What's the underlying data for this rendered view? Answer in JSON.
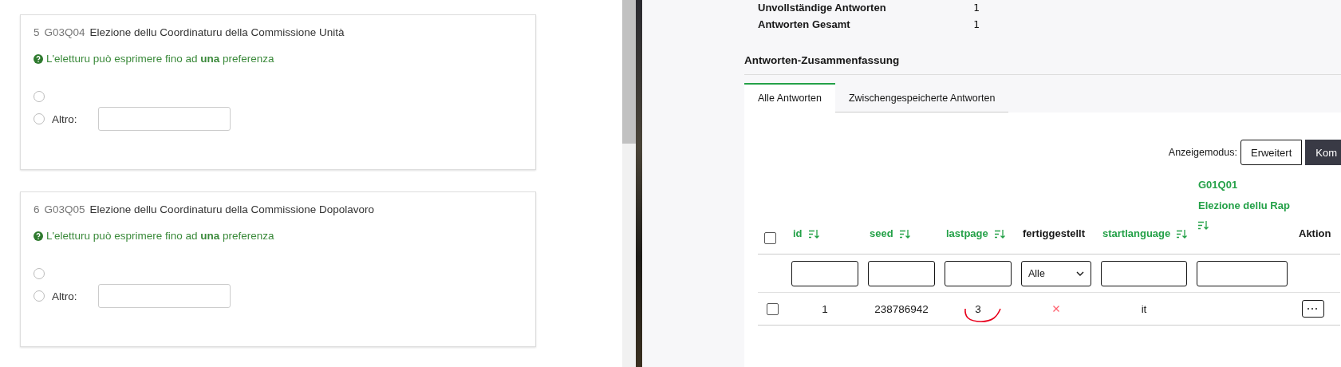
{
  "questions": [
    {
      "number": "5",
      "code": "G03Q04",
      "title": "Elezione dellu Coordinaturu della Commissione Unità",
      "help": "L'eletturu può esprimere fino ad **una** preferenza",
      "options": [
        {
          "kind": "blank",
          "selected": false
        },
        {
          "kind": "other",
          "label": "Altro:",
          "selected": false
        }
      ]
    },
    {
      "number": "6",
      "code": "G03Q05",
      "title": "Elezione dellu Coordinaturu della Commissione Dopolavoro",
      "help": "L'eletturu può esprimere fino ad **una** preferenza",
      "options": [
        {
          "kind": "blank",
          "selected": false
        },
        {
          "kind": "other",
          "label": "Altro:",
          "selected": false
        }
      ]
    }
  ],
  "stats": [
    {
      "label": "Unvollständige Antworten",
      "value": "1"
    },
    {
      "label": "Antworten Gesamt",
      "value": "1"
    }
  ],
  "summary_title": "Antworten-Zusammenfassung",
  "tabs": [
    {
      "label": "Alle Antworten",
      "selected": true
    },
    {
      "label": "Zwischengespeicherte Antworten",
      "selected": false
    }
  ],
  "display_mode": {
    "label": "Anzeigemodus:",
    "options": [
      {
        "label": "Erweitert",
        "selected": false
      },
      {
        "label": "Kom",
        "selected": true
      }
    ]
  },
  "table": {
    "select_all_checked": false,
    "columns": [
      {
        "label": "id",
        "sortable": true,
        "filter": {
          "kind": "text"
        }
      },
      {
        "label": "seed",
        "sortable": true,
        "filter": {
          "kind": "text"
        }
      },
      {
        "label": "lastpage",
        "sortable": true,
        "filter": {
          "kind": "text"
        }
      },
      {
        "label": "fertiggestellt",
        "sortable": false,
        "filter": {
          "kind": "select",
          "value": "Alle"
        }
      },
      {
        "label": "startlanguage",
        "sortable": true,
        "filter": {
          "kind": "text"
        }
      },
      {
        "code": "G01Q01",
        "label": "Elezione dellu Rap",
        "sortable": true,
        "filter": {
          "kind": "text"
        }
      },
      {
        "label": "Aktion",
        "sortable": false
      }
    ],
    "rows": [
      {
        "checked": false,
        "id": "1",
        "seed": "238786942",
        "lastpage": "3",
        "completed": false,
        "startlanguage": "it"
      }
    ]
  }
}
